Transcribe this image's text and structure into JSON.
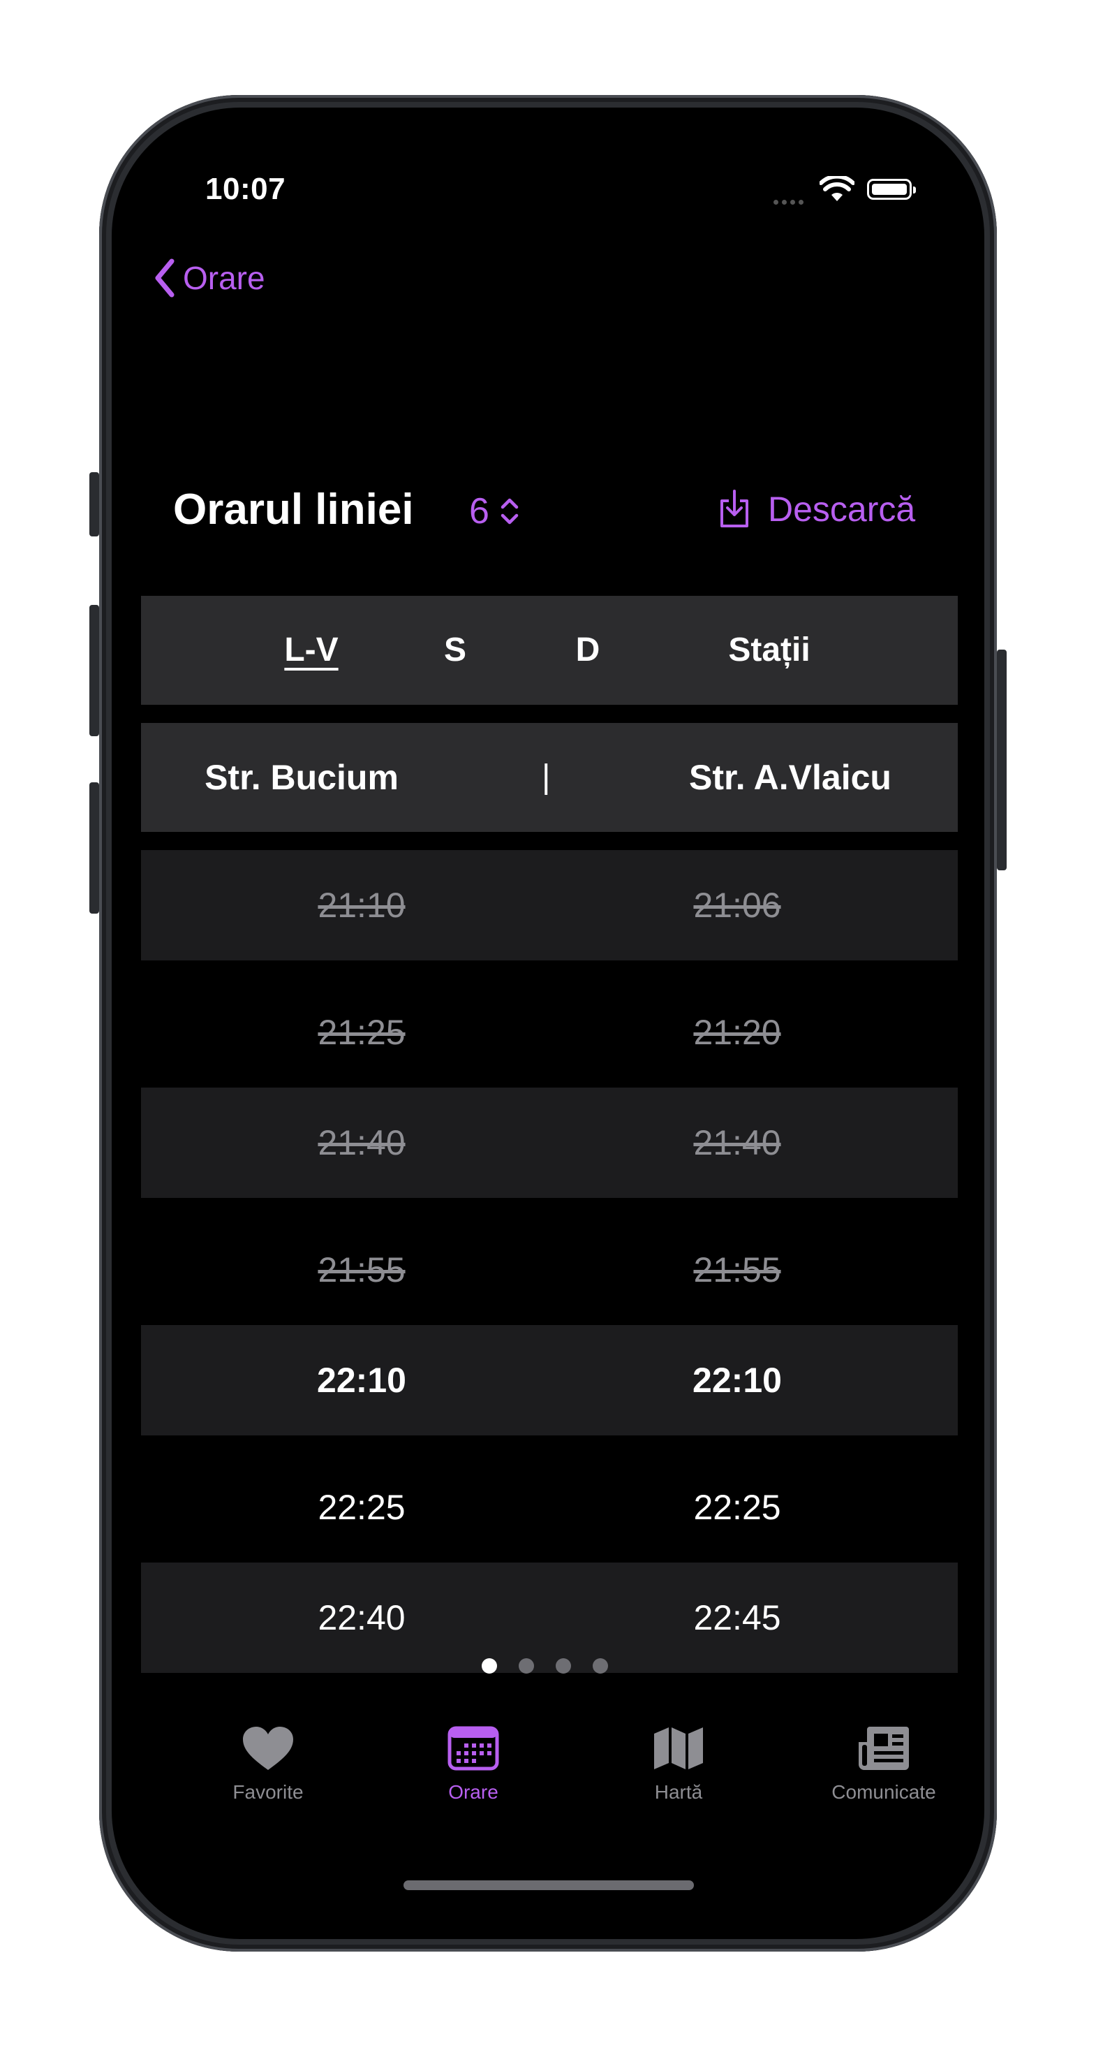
{
  "status": {
    "time": "10:07"
  },
  "nav": {
    "back_label": "Orare"
  },
  "header": {
    "title": "Orarul liniei",
    "line_number": "6",
    "download_label": "Descarcă"
  },
  "day_tabs": [
    {
      "label": "L-V",
      "active": true
    },
    {
      "label": "S",
      "active": false
    },
    {
      "label": "D",
      "active": false
    },
    {
      "label": "Stații",
      "active": false
    }
  ],
  "stops": {
    "from": "Str. Bucium",
    "separator": "|",
    "to": "Str. A.Vlaicu"
  },
  "schedule": [
    {
      "from": "21:10",
      "to": "21:06",
      "state": "past"
    },
    {
      "from": "21:25",
      "to": "21:20",
      "state": "past"
    },
    {
      "from": "21:40",
      "to": "21:40",
      "state": "past"
    },
    {
      "from": "21:55",
      "to": "21:55",
      "state": "past"
    },
    {
      "from": "22:10",
      "to": "22:10",
      "state": "next"
    },
    {
      "from": "22:25",
      "to": "22:25",
      "state": "upcoming"
    },
    {
      "from": "22:40",
      "to": "22:45",
      "state": "upcoming"
    }
  ],
  "pager": {
    "pages": 4,
    "current": 1
  },
  "tab_bar": [
    {
      "label": "Favorite",
      "icon": "heart-icon"
    },
    {
      "label": "Orare",
      "icon": "calendar-icon",
      "active": true
    },
    {
      "label": "Hartă",
      "icon": "map-icon"
    },
    {
      "label": "Comunicate",
      "icon": "newspaper-icon"
    }
  ],
  "colors": {
    "accent": "#b85ff0",
    "background": "#000000",
    "band": "#2c2c2e",
    "row_shade": "#1c1c1e",
    "muted": "#8e8e93"
  }
}
